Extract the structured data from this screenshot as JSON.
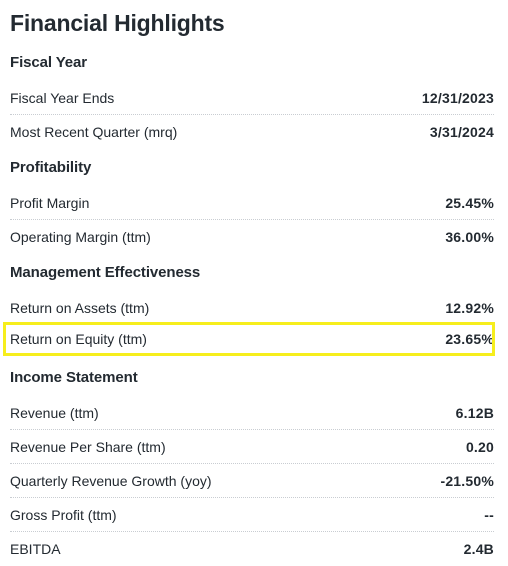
{
  "title": "Financial Highlights",
  "sections": [
    {
      "heading": "Fiscal Year",
      "rows": [
        {
          "label": "Fiscal Year Ends",
          "value": "12/31/2023"
        },
        {
          "label": "Most Recent Quarter (mrq)",
          "value": "3/31/2024"
        }
      ]
    },
    {
      "heading": "Profitability",
      "rows": [
        {
          "label": "Profit Margin",
          "value": "25.45%"
        },
        {
          "label": "Operating Margin (ttm)",
          "value": "36.00%"
        }
      ]
    },
    {
      "heading": "Management Effectiveness",
      "rows": [
        {
          "label": "Return on Assets (ttm)",
          "value": "12.92%"
        },
        {
          "label": "Return on Equity (ttm)",
          "value": "23.65%"
        }
      ]
    },
    {
      "heading": "Income Statement",
      "rows": [
        {
          "label": "Revenue (ttm)",
          "value": "6.12B"
        },
        {
          "label": "Revenue Per Share (ttm)",
          "value": "0.20"
        },
        {
          "label": "Quarterly Revenue Growth (yoy)",
          "value": "-21.50%"
        },
        {
          "label": "Gross Profit (ttm)",
          "value": "--"
        },
        {
          "label": "EBITDA",
          "value": "2.4B"
        }
      ]
    }
  ],
  "colors": {
    "highlight_border": "#f6ee1c",
    "text": "#232a31",
    "row_divider": "#c9cdd2"
  }
}
